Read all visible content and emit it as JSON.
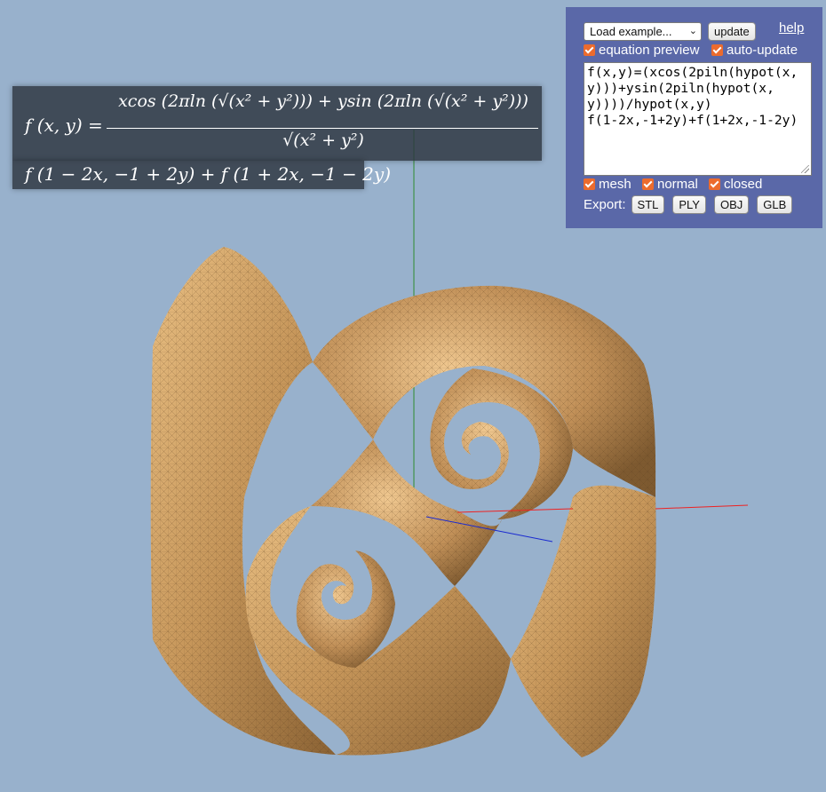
{
  "equation": {
    "lhs": "f (x, y) =",
    "numerator": "xcos (2πln (√(x² + y²))) + ysin (2πln (√(x² + y²)))",
    "denominator": "√(x² + y²)",
    "call": "f (1 − 2x, −1 + 2y) + f (1 + 2x, −1 − 2y)"
  },
  "panel": {
    "example_select": "Load example...",
    "update_label": "update",
    "help_label": "help",
    "equation_preview_label": "equation preview",
    "auto_update_label": "auto-update",
    "code": "f(x,y)=(xcos(2piln(hypot(x,y)))+ysin(2piln(hypot(x,y))))/hypot(x,y)\nf(1-2x,-1+2y)+f(1+2x,-1-2y)",
    "mesh_label": "mesh",
    "normal_label": "normal",
    "closed_label": "closed",
    "export_label": "Export:",
    "export_buttons": [
      "STL",
      "PLY",
      "OBJ",
      "GLB"
    ],
    "checkbox_color": "#ec6b2d",
    "panel_color": "#5a68a8"
  },
  "scene": {
    "background": "#98b1cc",
    "surface_color": "#c89a5c",
    "axis_colors": {
      "x": "#ff0000",
      "y": "#00aa00",
      "z": "#0000ff"
    }
  }
}
